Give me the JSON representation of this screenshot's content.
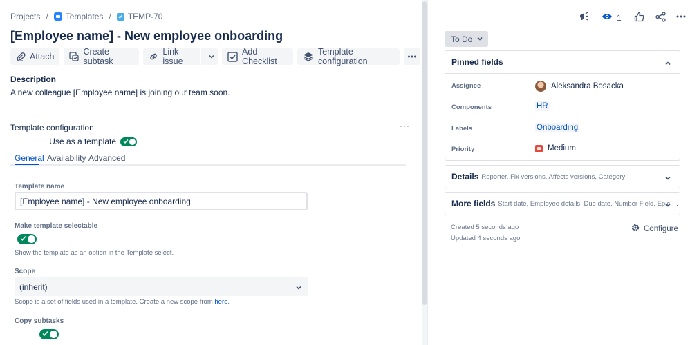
{
  "breadcrumb": {
    "projects": "Projects",
    "templates": "Templates",
    "issue_key": "TEMP-70"
  },
  "issue": {
    "title": "[Employee name] - New employee onboarding",
    "description_heading": "Description",
    "description": "A new colleague [Employee name] is joining our team soon."
  },
  "toolbar": {
    "attach": "Attach",
    "create_subtask": "Create subtask",
    "link_issue": "Link issue",
    "add_checklist": "Add Checklist",
    "template_configuration": "Template configuration"
  },
  "template_config": {
    "title": "Template configuration",
    "use_as_template_label": "Use as a template",
    "use_as_template": true,
    "tabs": [
      {
        "label": "General",
        "active": true
      },
      {
        "label": "Availability",
        "active": false
      },
      {
        "label": "Advanced",
        "active": false
      }
    ],
    "template_name_label": "Template name",
    "template_name_value": "[Employee name] - New employee onboarding",
    "selectable_label": "Make template selectable",
    "selectable": true,
    "selectable_help": "Show the template as an option in the Template select.",
    "scope_label": "Scope",
    "scope_value": "(inherit)",
    "scope_help_prefix": "Scope is a set of fields used in a template. Create a new scope from ",
    "scope_help_link": "here",
    "scope_help_suffix": ".",
    "copy_subtasks_label": "Copy subtasks",
    "copy_subtasks": true
  },
  "topbar": {
    "watch_count": "1"
  },
  "status": {
    "label": "To Do"
  },
  "pinned": {
    "heading": "Pinned fields",
    "fields": [
      {
        "label": "Assignee",
        "value": "Aleksandra Bosacka"
      },
      {
        "label": "Components",
        "value": "HR"
      },
      {
        "label": "Labels",
        "value": "Onboarding"
      },
      {
        "label": "Priority",
        "value": "Medium"
      }
    ]
  },
  "details": {
    "heading": "Details",
    "sub": "Reporter, Fix versions, Affects versions, Category"
  },
  "more_fields": {
    "heading": "More fields",
    "sub": "Start date, Employee details, Due date, Number Field, Epic L..."
  },
  "meta": {
    "created": "Created 5 seconds ago",
    "updated": "Updated 4 seconds ago",
    "configure": "Configure"
  },
  "colors": {
    "accent": "#0052cc",
    "toggle_on": "#00875a",
    "priority_medium": "#e5493a"
  }
}
